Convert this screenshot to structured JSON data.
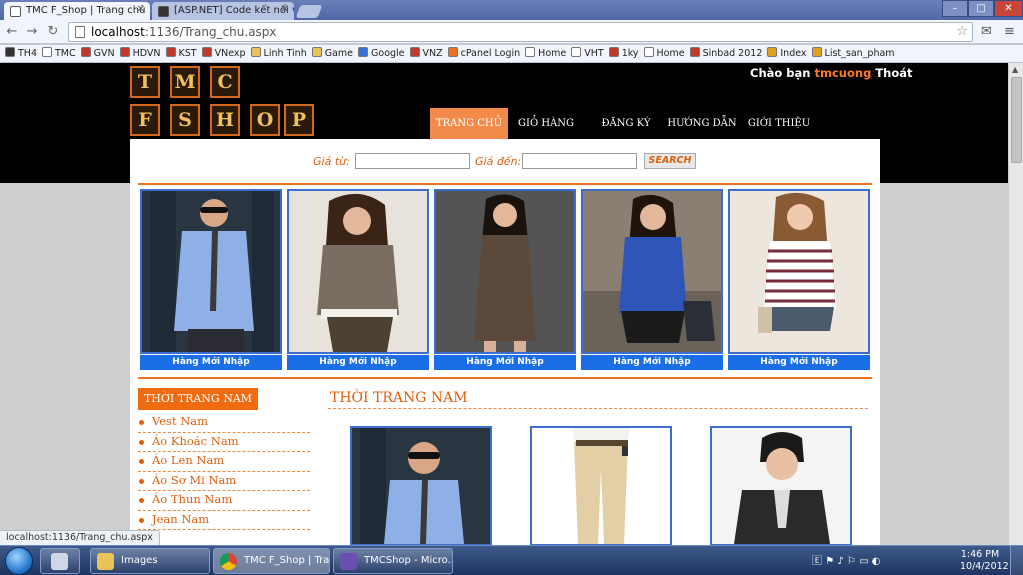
{
  "browser": {
    "tabs": [
      {
        "title": "TMC F_Shop | Trang chủ",
        "active": true
      },
      {
        "title": "[ASP.NET] Code kết nối vớ",
        "active": false
      }
    ],
    "url_host": "localhost",
    "url_path": ":1136/Trang_chu.aspx",
    "bookmarks": [
      {
        "label": "TH4",
        "icon": "github-icon"
      },
      {
        "label": "TMC",
        "icon": "page-icon"
      },
      {
        "label": "GVN",
        "icon": "brand-icon"
      },
      {
        "label": "HDVN",
        "icon": "brand-icon"
      },
      {
        "label": "KST",
        "icon": "brand-icon"
      },
      {
        "label": "VNexp",
        "icon": "brand-icon"
      },
      {
        "label": "Linh Tinh",
        "icon": "folder-icon"
      },
      {
        "label": "Game",
        "icon": "folder-icon"
      },
      {
        "label": "Google",
        "icon": "google-icon"
      },
      {
        "label": "VNZ",
        "icon": "brand-icon"
      },
      {
        "label": "cPanel Login",
        "icon": "cpanel-icon"
      },
      {
        "label": "Home",
        "icon": "page-icon"
      },
      {
        "label": "VHT",
        "icon": "page-icon"
      },
      {
        "label": "1ky",
        "icon": "brand-icon"
      },
      {
        "label": "Home",
        "icon": "page-icon"
      },
      {
        "label": "Sinbad 2012",
        "icon": "brand-icon"
      },
      {
        "label": "Index",
        "icon": "star-icon"
      },
      {
        "label": "List_san_pham",
        "icon": "star-icon"
      }
    ],
    "status_text": "localhost:1136/Trang_chu.aspx"
  },
  "site": {
    "logo_letters": [
      "T",
      "M",
      "C",
      "F",
      "S",
      "H",
      "O",
      "P"
    ],
    "greeting_prefix": "Chào bạn",
    "username": "tmcuong",
    "logout": "Thoát",
    "menu": [
      "TRANG CHỦ",
      "GIỎ HÀNG",
      "ĐĂNG KÝ",
      "HƯỚNG DẪN",
      "GIỚI THIỆU"
    ],
    "search": {
      "price_from_label": "Giá từ:",
      "price_to_label": "Giá đến:",
      "button_label": "SEARCH"
    },
    "featured": [
      {
        "caption": "Hàng Mới Nhập"
      },
      {
        "caption": "Hàng Mới Nhập"
      },
      {
        "caption": "Hàng Mới Nhập"
      },
      {
        "caption": "Hàng Mới Nhập"
      },
      {
        "caption": "Hàng Mới Nhập"
      }
    ],
    "category_header": "THỜI TRANG NAM",
    "categories": [
      "Vest Nam",
      "Áo Khoác Nam",
      "Áo Len Nam",
      "Áo Sơ Mi Nam",
      "Áo Thun Nam",
      "Jean Nam"
    ],
    "section_title": "THỜI TRANG NAM"
  },
  "taskbar": {
    "buttons": [
      "Images",
      "TMC F_Shop | Tra...",
      "TMCShop - Micro..."
    ],
    "time": "1:46 PM",
    "date": "10/4/2012"
  },
  "colors": {
    "accent": "#f06a10",
    "caption_blue": "#1a6fe8",
    "menu_active": "#f28a4a"
  }
}
